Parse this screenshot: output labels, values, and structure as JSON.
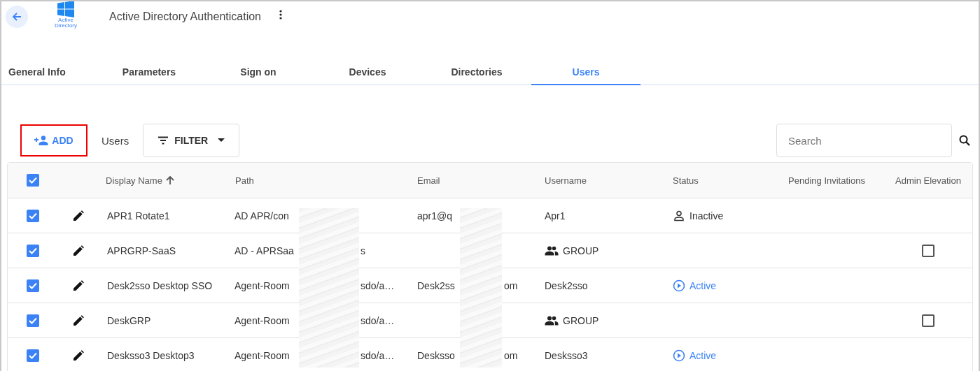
{
  "header": {
    "title": "Active Directory Authentication",
    "logo_caption": "Active Directory"
  },
  "tabs": [
    {
      "label": "General Info",
      "selected": false
    },
    {
      "label": "Parameters",
      "selected": false
    },
    {
      "label": "Sign on",
      "selected": false
    },
    {
      "label": "Devices",
      "selected": false
    },
    {
      "label": "Directories",
      "selected": false
    },
    {
      "label": "Users",
      "selected": true
    }
  ],
  "toolbar": {
    "add_button": "ADD",
    "label": "Users",
    "filter_button": "FILTER",
    "search": {
      "placeholder": "Search"
    }
  },
  "table": {
    "select_all_checked": true,
    "columns": [
      {
        "label": "Display Name",
        "sorted_ascending": true
      },
      {
        "label": "Path"
      },
      {
        "label": "Email"
      },
      {
        "label": "Username"
      },
      {
        "label": "Status"
      },
      {
        "label": "Pending Invitations"
      },
      {
        "label": "Admin Elevation"
      }
    ],
    "rows": [
      {
        "checked": true,
        "display_name": "APR1 Rotate1",
        "path": "AD APR/con",
        "email": "apr1@q",
        "username": {
          "kind": "user",
          "text": "Apr1"
        },
        "status": {
          "kind": "inactive",
          "text": "Inactive"
        }
      },
      {
        "checked": true,
        "display_name": "APRGRP-SaaS",
        "path": "AD - APRSaa",
        "path_end": "s",
        "username": {
          "kind": "group",
          "text": "GROUP"
        },
        "admin_elevation": {
          "checked": false
        }
      },
      {
        "checked": true,
        "display_name": "Desk2sso Desktop SSO",
        "path": "Agent-Room",
        "path_end": "sdo/a…",
        "email": "Desk2ss",
        "email_end": "om",
        "username": {
          "kind": "user",
          "text": "Desk2sso"
        },
        "status": {
          "kind": "active",
          "text": "Active"
        }
      },
      {
        "checked": true,
        "display_name": "DeskGRP",
        "path": "Agent-Room",
        "path_end": "sdo/a…",
        "username": {
          "kind": "group",
          "text": "GROUP"
        },
        "admin_elevation": {
          "checked": false
        }
      },
      {
        "checked": true,
        "display_name": "Desksso3 Desktop3",
        "path": "Agent-Room",
        "path_end": "sdo/a…",
        "email": "Desksso",
        "email_end": "om",
        "username": {
          "kind": "user",
          "text": "Desksso3"
        },
        "status": {
          "kind": "active",
          "text": "Active"
        }
      }
    ]
  }
}
